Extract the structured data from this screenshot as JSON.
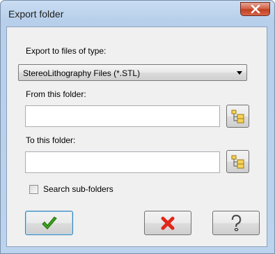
{
  "window": {
    "title": "Export folder"
  },
  "export_type": {
    "label": "Export to files of type:",
    "selected": "StereoLithography Files (*.STL)"
  },
  "from_folder": {
    "label": "From this folder:",
    "value": ""
  },
  "to_folder": {
    "label": "To this folder:",
    "value": ""
  },
  "search_subfolders": {
    "label": "Search sub-folders",
    "checked": false
  },
  "icons": {
    "close": "close-icon",
    "browse": "folder-tree-icon",
    "ok": "green-checkmark-icon",
    "cancel": "red-x-icon",
    "help": "question-mark-icon"
  },
  "colors": {
    "title_bar": "#bcd3ee",
    "close_button": "#c2401f",
    "ok_check": "#3aa51a",
    "cancel_x": "#e2261a"
  }
}
